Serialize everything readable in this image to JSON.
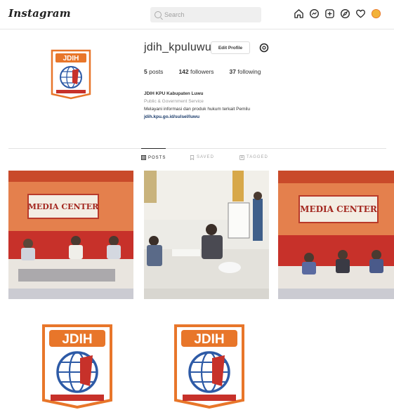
{
  "topbar": {
    "brand": "Instagram",
    "search_placeholder": "Search",
    "nav_icons": [
      "home-icon",
      "messenger-icon",
      "new-post-icon",
      "explore-icon",
      "heart-icon",
      "profile-avatar"
    ]
  },
  "profile": {
    "username": "jdih_kpuluwu",
    "edit_profile_label": "Edit Profile",
    "stats": {
      "posts_count": "5",
      "posts_label": "posts",
      "followers_count": "142",
      "followers_label": "followers",
      "following_count": "37",
      "following_label": "following"
    },
    "bio": {
      "name": "JDIH KPU Kabupaten Luwu",
      "category": "Public & Government Service",
      "description": "Melayani informasi dan produk hukum terkait Pemilu",
      "link": "jdih.kpu.go.id/sulsel/luwu"
    }
  },
  "tabs": [
    {
      "label": "POSTS",
      "active": true
    },
    {
      "label": "SAVED",
      "active": false
    },
    {
      "label": "TAGGED",
      "active": false
    }
  ],
  "posts": [
    {
      "banner": "MEDIA CENTER",
      "kind": "media-center"
    },
    {
      "banner": "",
      "kind": "meeting-room"
    },
    {
      "banner": "MEDIA CENTER",
      "kind": "media-center"
    }
  ],
  "logo": {
    "text": "JDIH"
  },
  "colors": {
    "accent_orange": "#e8762a",
    "globe_blue": "#2d5aa6",
    "banner_red": "#c7312a"
  }
}
